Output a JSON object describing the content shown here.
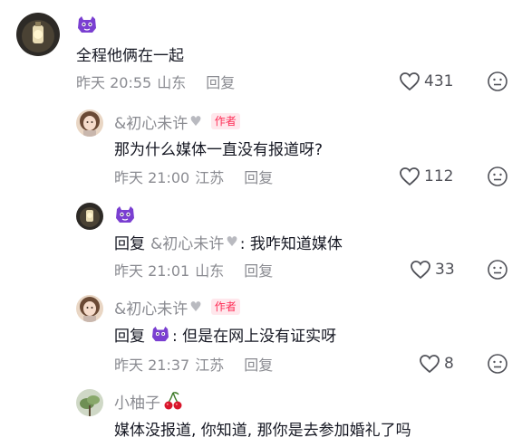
{
  "comments": [
    {
      "content": "全程他俩在一起",
      "time": "昨天 20:55",
      "location": "山东",
      "reply_label": "回复",
      "likes": "431"
    },
    {
      "username": "&初心未许",
      "author_tag": "作者",
      "content": "那为什么媒体一直没有报道呀?",
      "time": "昨天 21:00",
      "location": "江苏",
      "reply_label": "回复",
      "likes": "112"
    },
    {
      "reply_word": "回复",
      "reply_target": "&初心未许",
      "content": ": 我咋知道媒体",
      "time": "昨天 21:01",
      "location": "山东",
      "reply_label": "回复",
      "likes": "33"
    },
    {
      "username": "&初心未许",
      "author_tag": "作者",
      "reply_word": "回复",
      "content": ": 但是在网上没有证实呀",
      "time": "昨天 21:37",
      "location": "江苏",
      "reply_label": "回复",
      "likes": "8"
    },
    {
      "username": "小柚子",
      "content": "媒体没报道, 你知道, 那你是去参加婚礼了吗"
    }
  ],
  "colors": {
    "meta_gray": "#8a8b91",
    "author_tag_red": "#fe2c55",
    "author_tag_bg": "#ffe7ec",
    "mascot_purple": "#7a3fd1"
  }
}
